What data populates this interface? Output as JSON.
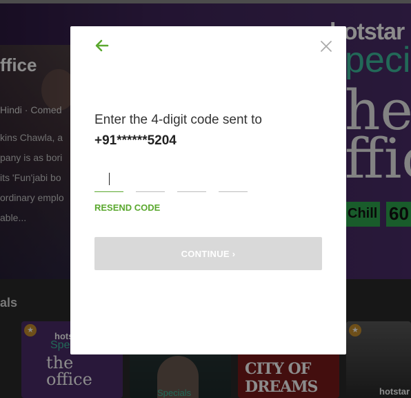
{
  "background": {
    "hero": {
      "title": "ffice",
      "meta": "Hindi · Comed",
      "description_lines": [
        "kins Chawla, a",
        "pany is as bori",
        " its 'Fun'jabi bo",
        "ordinary emplo",
        "able..."
      ]
    },
    "poster": {
      "brand": "hotstar",
      "specials": "pecia",
      "title_line1": "he",
      "title_line2": "ffic",
      "tag_chill": "Chill",
      "tag_number": "60"
    },
    "section": {
      "title": "als",
      "tiles": [
        {
          "brand": "hotst",
          "specials": "Spe",
          "title": "the office"
        },
        {
          "caption": "Specials"
        },
        {
          "title": "CITY OF DREAMS"
        },
        {
          "brand": "hotstar"
        }
      ]
    }
  },
  "modal": {
    "prompt_text": "Enter the 4-digit code sent to",
    "phone": "+91******5204",
    "otp_digits": [
      "",
      "",
      "",
      ""
    ],
    "resend_label": "RESEND CODE",
    "continue_label": "CONTINUE ›",
    "colors": {
      "accent": "#5aa82e",
      "disabled_button": "#d9d9d9"
    }
  }
}
